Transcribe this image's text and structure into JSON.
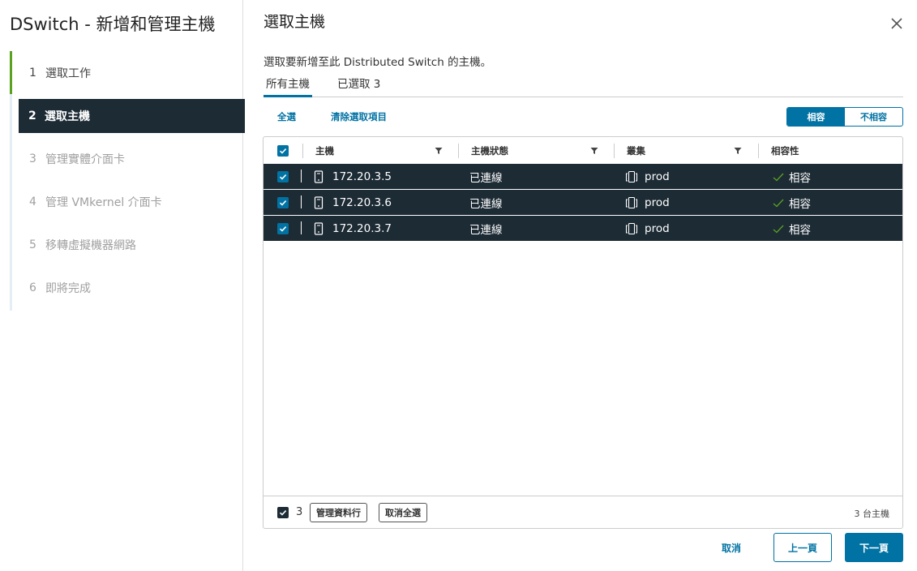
{
  "wizard": {
    "title": "DSwitch - 新增和管理主機"
  },
  "steps": [
    {
      "num": "1",
      "label": "選取工作"
    },
    {
      "num": "2",
      "label": "選取主機"
    },
    {
      "num": "3",
      "label": "管理實體介面卡"
    },
    {
      "num": "4",
      "label": "管理 VMkernel 介面卡"
    },
    {
      "num": "5",
      "label": "移轉虛擬機器網路"
    },
    {
      "num": "6",
      "label": "即將完成"
    }
  ],
  "page": {
    "title": "選取主機",
    "description": "選取要新增至此 Distributed Switch 的主機。"
  },
  "tabs": {
    "all": "所有主機",
    "selected": "已選取 3"
  },
  "actions": {
    "select_all": "全選",
    "clear_selection": "清除選取項目"
  },
  "toggle": {
    "compatible": "相容",
    "incompatible": "不相容"
  },
  "columns": {
    "host": "主機",
    "state": "主機狀態",
    "cluster": "叢集",
    "compat": "相容性"
  },
  "rows": [
    {
      "host": "172.20.3.5",
      "state": "已連線",
      "cluster": "prod",
      "compat": "相容"
    },
    {
      "host": "172.20.3.6",
      "state": "已連線",
      "cluster": "prod",
      "compat": "相容"
    },
    {
      "host": "172.20.3.7",
      "state": "已連線",
      "cluster": "prod",
      "compat": "相容"
    }
  ],
  "grid_footer": {
    "selected_count": "3",
    "manage_columns": "管理資料行",
    "deselect_all": "取消全選",
    "total": "3 台主機"
  },
  "buttons": {
    "cancel": "取消",
    "back": "上一頁",
    "next": "下一頁"
  },
  "colors": {
    "accent": "#0072a3",
    "selected_row": "#1d2b35",
    "done_step": "#5aa220"
  }
}
